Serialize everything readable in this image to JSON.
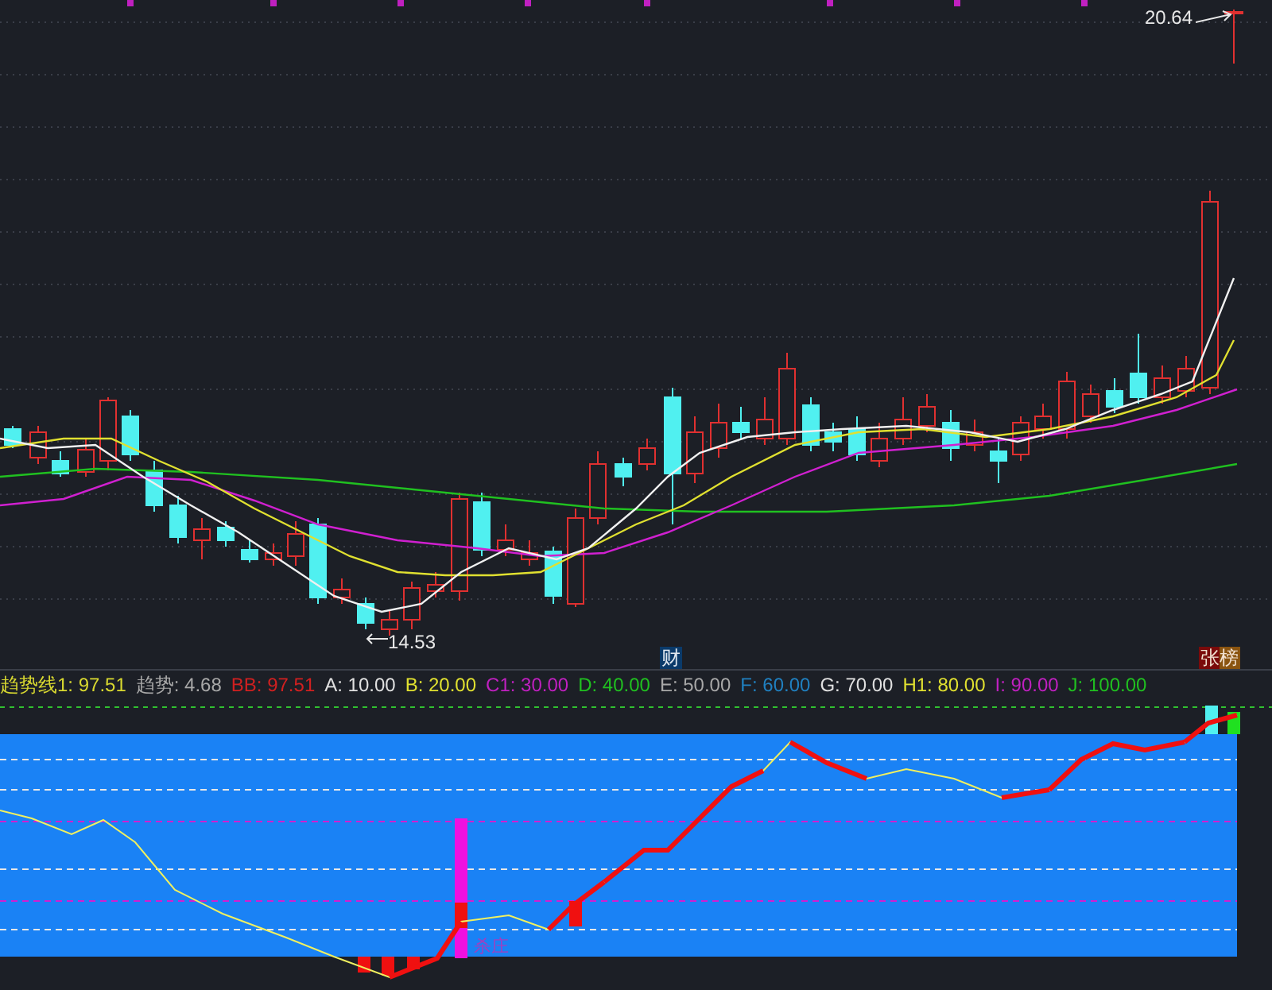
{
  "price_chart": {
    "high_label": "20.64",
    "low_label": "14.53",
    "markers": [
      {
        "kind": "finance",
        "text": "财"
      },
      {
        "kind": "limit",
        "text": "张榜"
      }
    ]
  },
  "indicator_legend": [
    {
      "text": "趋势线1: 97.51",
      "color": "#d8d830"
    },
    {
      "text": "趋势: 4.68",
      "color": "#a8a8a8"
    },
    {
      "text": "BB: 97.51",
      "color": "#d02020"
    },
    {
      "text": "A: 10.00",
      "color": "#e0e0e0"
    },
    {
      "text": "B: 20.00",
      "color": "#e0e030"
    },
    {
      "text": "C1: 30.00",
      "color": "#c020c0"
    },
    {
      "text": "D: 40.00",
      "color": "#20c020"
    },
    {
      "text": "E: 50.00",
      "color": "#a8a8a8"
    },
    {
      "text": "F: 60.00",
      "color": "#2080c0"
    },
    {
      "text": "G: 70.00",
      "color": "#e0e0e0"
    },
    {
      "text": "H1: 80.00",
      "color": "#e0e030"
    },
    {
      "text": "I: 90.00",
      "color": "#c020c0"
    },
    {
      "text": "J: 100.00",
      "color": "#20c020"
    }
  ],
  "indicator_panel": {
    "signal_label": "杀庄"
  }
}
